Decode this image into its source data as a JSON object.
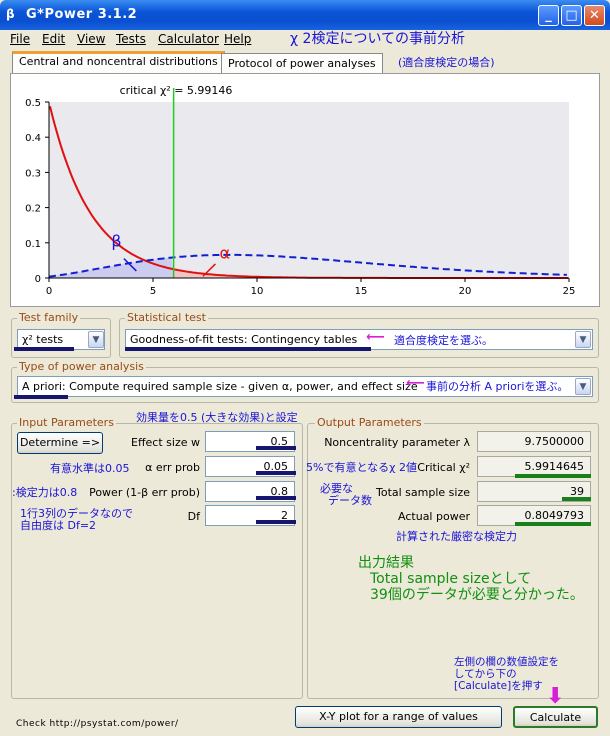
{
  "window": {
    "title": "G*Power 3.1.2",
    "icon": "gpower-app-icon"
  },
  "menu": [
    "File",
    "Edit",
    "View",
    "Tests",
    "Calculator",
    "Help"
  ],
  "annotations": {
    "title": "χ 2検定についての事前分析",
    "subtitle": "(適合度検定の場合)",
    "stat_test": "適合度検定を選ぶ。",
    "power_analysis": "事前の分析 A prioriを選ぶ。",
    "effect_size": "効果量を0.5 (大きな効果)と設定",
    "alpha": "有意水準は0.05",
    "power": ":検定力は0.8",
    "df": [
      "1行3列のデータなので",
      "自由度は  Df=2"
    ],
    "critical": "5%で有意となるχ 2値",
    "sample_size": [
      "必要な",
      "データ数"
    ],
    "actual_power": "計算された厳密な検定力",
    "result": [
      "出力結果",
      "Total sample sizeとして",
      "39個のデータが必要と分かった。"
    ],
    "calculate": [
      "左側の欄の数値設定を",
      "してから下の",
      "[Calculate]を押す"
    ]
  },
  "tabs": [
    {
      "label": "Central and noncentral distributions",
      "active": true
    },
    {
      "label": "Protocol of power analyses",
      "active": false
    }
  ],
  "chart_data": {
    "type": "line",
    "critical_label": "critical χ² = 5.99146",
    "critical_value": 5.99146,
    "df": 2,
    "noncentrality": 9.75,
    "xlim": [
      0,
      25
    ],
    "ylim": [
      0,
      0.5
    ],
    "x_ticks": [
      "0",
      "5",
      "10",
      "15",
      "20",
      "25"
    ],
    "y_ticks": [
      "0",
      "0.1",
      "0.2",
      "0.3",
      "0.4",
      "0.5"
    ],
    "series": [
      {
        "color": "#e01010",
        "style": "solid"
      },
      {
        "color": "#1020d0",
        "style": "dashed"
      }
    ],
    "beta_label": "β",
    "alpha_label": "α"
  },
  "test_family": {
    "title": "Test family",
    "value": "χ² tests"
  },
  "statistical_test": {
    "title": "Statistical test",
    "value": "Goodness-of-fit tests: Contingency tables"
  },
  "power_analysis": {
    "title": "Type of power analysis",
    "value": "A priori: Compute required sample size - given α, power, and effect size"
  },
  "input": {
    "title": "Input Parameters",
    "determine_label": "Determine =>",
    "rows": [
      {
        "label": "Effect size w",
        "value": "0.5"
      },
      {
        "label": "α err prob",
        "value": "0.05"
      },
      {
        "label": "Power (1-β err prob)",
        "value": "0.8"
      },
      {
        "label": "Df",
        "value": "2"
      }
    ]
  },
  "output": {
    "title": "Output Parameters",
    "rows": [
      {
        "label": "Noncentrality parameter λ",
        "value": "9.7500000"
      },
      {
        "label": "Critical χ²",
        "value": "5.9914645"
      },
      {
        "label": "Total sample size",
        "value": "39"
      },
      {
        "label": "Actual power",
        "value": "0.8049793"
      }
    ]
  },
  "footer": {
    "check_url": "Check http://psystat.com/power/",
    "xy_label": "X-Y plot for a range of values",
    "calculate_label": "Calculate"
  },
  "colors": {
    "accent_pink": "#d81fd8",
    "annotation_blue": "#1a14d8",
    "annotation_green": "#109010",
    "underline_navy": "#17166e",
    "underline_green": "#17801a"
  }
}
